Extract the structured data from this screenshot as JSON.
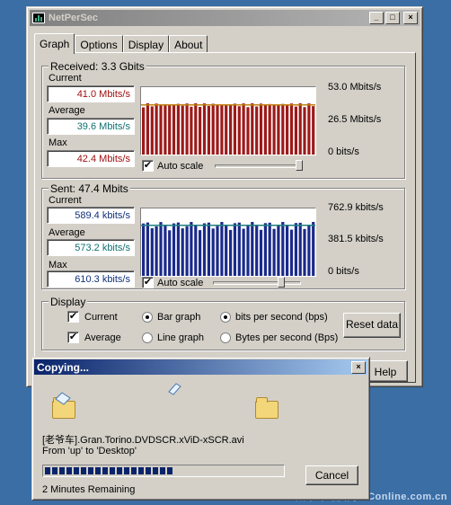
{
  "window": {
    "title": "NetPerSec",
    "min": "_",
    "max": "□",
    "close": "×"
  },
  "tabs": [
    "Graph",
    "Options",
    "Display",
    "About"
  ],
  "received": {
    "title": "Received: 3.3 Gbits",
    "current_label": "Current",
    "current": "41.0 Mbits/s",
    "average_label": "Average",
    "average": "39.6 Mbits/s",
    "max_label": "Max",
    "max": "42.4 Mbits/s",
    "scale_top": "53.0 Mbits/s",
    "scale_mid": "26.5 Mbits/s",
    "scale_bottom": "0  bits/s",
    "autoscale_label": "Auto scale",
    "autoscale_checked": true,
    "bar_color": "#9c1a1a",
    "avg_color": "#c08010",
    "slider_pos": 1.0
  },
  "sent": {
    "title": "Sent: 47.4 Mbits",
    "current_label": "Current",
    "current": "589.4 kbits/s",
    "average_label": "Average",
    "average": "573.2 kbits/s",
    "max_label": "Max",
    "max": "610.3 kbits/s",
    "scale_top": "762.9 kbits/s",
    "scale_mid": "381.5 kbits/s",
    "scale_bottom": "0  bits/s",
    "autoscale_label": "Auto scale",
    "autoscale_checked": true,
    "bar_color": "#1a2a8a",
    "avg_color": "#208080",
    "slider_pos": 0.8
  },
  "display": {
    "title": "Display",
    "current_label": "Current",
    "current_checked": true,
    "average_label": "Average",
    "average_checked": true,
    "bar_graph": "Bar graph",
    "line_graph": "Line graph",
    "graph_mode": "bar",
    "bps": "bits per second (bps)",
    "Bps": "Bytes per second (Bps)",
    "unit_mode": "bps",
    "reset": "Reset data"
  },
  "help_button": "Help",
  "copy_dialog": {
    "title": "Copying...",
    "close": "×",
    "filename": "[老爷车].Gran.Torino.DVDSCR.xViD-xSCR.avi",
    "from_to": "From 'up' to 'Desktop'",
    "progress": 0.55,
    "remaining": "2 Minutes Remaining",
    "cancel": "Cancel"
  },
  "watermark": "太平洋电脑网 PConline.com.cn"
}
